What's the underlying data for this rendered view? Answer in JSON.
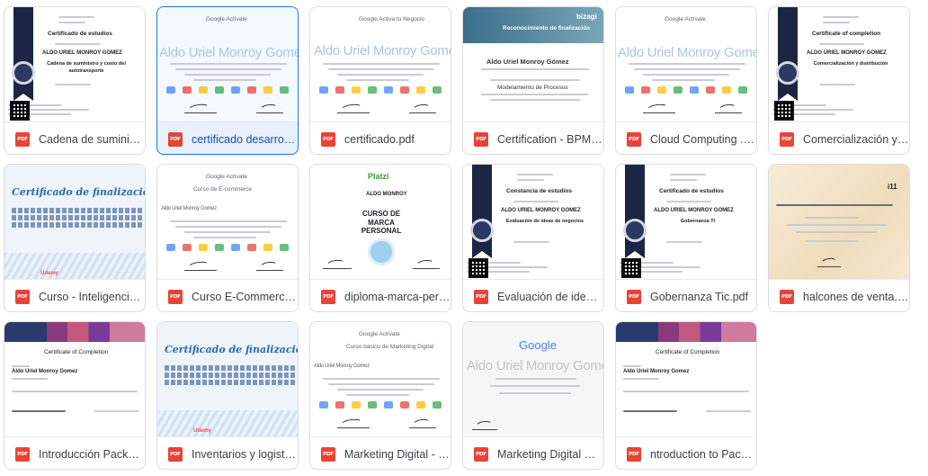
{
  "files": [
    {
      "name": "Cadena de suministro y costo del autotransporte.pdf",
      "display": "Cadena de suministro ...",
      "type": "PDF",
      "selected": false,
      "preview": {
        "style": "navy-ribbon",
        "header": "Certificado de estudios",
        "person": "ALDO URIEL MONROY GOMEZ",
        "course": "Cadena de suministro y costo del autotransporte"
      }
    },
    {
      "name": "certificado desarrollo ...",
      "display": "certificado desarrollo ...",
      "type": "PDF",
      "selected": true,
      "preview": {
        "style": "google",
        "brand": "Google Actívate",
        "person": "Aldo Uriel Monroy Gomez"
      }
    },
    {
      "name": "certificado.pdf",
      "display": "certificado.pdf",
      "type": "PDF",
      "selected": false,
      "preview": {
        "style": "google-plain",
        "brand": "Google Activa tu Negocio",
        "person": "Aldo Uriel Monroy Gomez"
      }
    },
    {
      "name": "Certification - BPM.pdf",
      "display": "Certification - BPM.pdf",
      "type": "PDF",
      "selected": false,
      "preview": {
        "style": "bizagi",
        "brand": "bizagi",
        "header": "Reconocimiento de finalización",
        "person": "Aldo Uriel Monroy Gómez",
        "course": "Modelamiento de Procesos"
      }
    },
    {
      "name": "Cloud Computing . cer...",
      "display": "Cloud Computing . cer...",
      "type": "PDF",
      "selected": false,
      "preview": {
        "style": "google",
        "brand": "Google Actívate",
        "person": "Aldo Uriel Monroy Gomez"
      }
    },
    {
      "name": "Comercialización y dis...",
      "display": "Comercialización y dis...",
      "type": "PDF",
      "selected": false,
      "preview": {
        "style": "navy-ribbon",
        "header": "Certificate of completion",
        "person": "ALDO URIEL MONROY GOMEZ",
        "course": "Comercialización y distribución"
      }
    },
    {
      "name": "Curso - Inteligencia e...",
      "display": "Curso - Inteligencia e...",
      "type": "PDF",
      "selected": false,
      "preview": {
        "style": "udemy",
        "header": "Certificado de finalización",
        "brand": "Udemy"
      }
    },
    {
      "name": "Curso E-Commerce.pdf",
      "display": "Curso E-Commerce.pdf",
      "type": "PDF",
      "selected": false,
      "preview": {
        "style": "google-plain",
        "brand": "Google Actívate",
        "header": "Curso de E-commerce",
        "person": "Aldo Uriel Monroy Gomez"
      }
    },
    {
      "name": "diploma-marca-person...",
      "display": "diploma-marca-person...",
      "type": "PDF",
      "selected": false,
      "preview": {
        "style": "platzi",
        "brand": "Platzi",
        "person": "ALDO MONROY",
        "course": "CURSO DE MARCA PERSONAL"
      }
    },
    {
      "name": "Evaluación de ideas de...",
      "display": "Evaluación de ideas de...",
      "type": "PDF",
      "selected": false,
      "preview": {
        "style": "navy-ribbon",
        "header": "Constancia de estudios",
        "person": "ALDO URIEL MONROY GOMEZ",
        "course": "Evaluación de ideas de negocios"
      }
    },
    {
      "name": "Gobernanza Tic.pdf",
      "display": "Gobernanza Tic.pdf",
      "type": "PDF",
      "selected": false,
      "preview": {
        "style": "navy-ribbon",
        "header": "Certificado de estudios",
        "person": "ALDO URIEL MONROY GOMEZ",
        "course": "Gobernanza TI"
      }
    },
    {
      "name": "halcones de venta.pdf",
      "display": "halcones de venta.pdf",
      "type": "PDF",
      "selected": false,
      "preview": {
        "style": "parchment",
        "brand": "i11"
      }
    },
    {
      "name": "Introducción Packett-...",
      "display": "Introducción Packett-...",
      "type": "PDF",
      "selected": false,
      "preview": {
        "style": "cisco",
        "header": "Certificate of Completion",
        "person": "Aldo Uriel Monroy Gomez"
      }
    },
    {
      "name": "Inventarios y logística ...",
      "display": "Inventarios y logistica ...",
      "type": "PDF",
      "selected": false,
      "preview": {
        "style": "udemy",
        "header": "Certificado de finalización",
        "brand": "Udemy"
      }
    },
    {
      "name": "Marketing Digital - Go...",
      "display": "Marketing Digital - Go...",
      "type": "PDF",
      "selected": false,
      "preview": {
        "style": "google-plain",
        "brand": "Google Actívate",
        "header": "Curso básico de Marketing Digital",
        "person": "Aldo Uriel Monroy Gomez"
      }
    },
    {
      "name": "Marketing Digital GD G...",
      "display": "Marketing Digital GD G...",
      "type": "PDF",
      "selected": false,
      "preview": {
        "style": "google-big",
        "brand": "Google",
        "person": "Aldo Uriel Monroy Gomez"
      }
    },
    {
      "name": "ntroduction to Pack-C...",
      "display": "ntroduction to Pack-C...",
      "type": "PDF",
      "selected": false,
      "preview": {
        "style": "cisco",
        "header": "Certificate of Completion",
        "person": "Aldo Uriel Monroy Gomez"
      }
    }
  ]
}
